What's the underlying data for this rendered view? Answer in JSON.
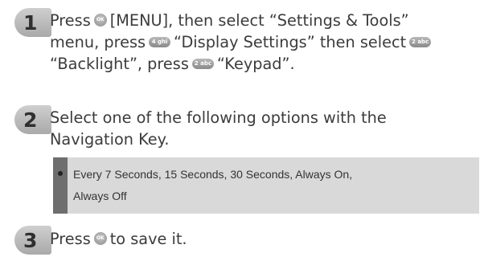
{
  "steps": [
    {
      "number": "1",
      "lines": [
        {
          "a": "Press",
          "b": "[MENU], then select “Settings & Tools”"
        },
        {
          "a": "menu, press",
          "b": "“Display Settings” then select"
        },
        {
          "a": "“Backlight”, press",
          "b": "“Keypad”."
        }
      ]
    },
    {
      "number": "2",
      "lines": [
        "Select one of the following options with the",
        "Navigation Key."
      ]
    },
    {
      "number": "3",
      "lines": [
        {
          "a": "Press",
          "b": "to save it."
        }
      ]
    }
  ],
  "options": {
    "line1": "Every 7 Seconds, 15 Seconds, 30 Seconds, Always On,",
    "line2": "Always Off"
  },
  "icons": {
    "ok_key": "ok-key-icon",
    "key_4": "4-ghi-key-icon",
    "key_2": "2-abc-key-icon"
  },
  "key_glyphs": {
    "key_4": "4 ghi",
    "key_2": "2 abc"
  }
}
